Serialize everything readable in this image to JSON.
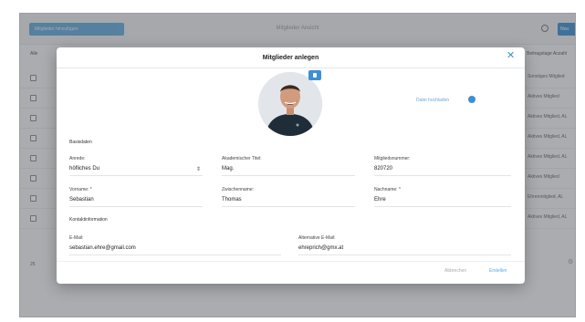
{
  "background": {
    "topbar_button": "Mitglieder hinzufügen",
    "title": "Mitglieder Ansicht",
    "new_button": "Neu",
    "subbar_left": "Alle",
    "subbar_right": "Beitragslage Anzahl",
    "row_statuses": [
      "Sonstiges Mitglied",
      "Aktives Mitglied",
      "Aktives Mitglied, AL",
      "Aktives Mitglied, AL",
      "Aktives Mitglied, AL",
      "Aktives Mitglied",
      "Ehrenmitglied, AL",
      "Aktives Mitglied, AL"
    ],
    "pager": "25"
  },
  "modal": {
    "title": "Mitglieder anlegen",
    "close_label": "✕",
    "link_text": "Datei hochladen",
    "section_basic": "Basisdaten",
    "section_contact": "Kontaktinformation",
    "fields": {
      "anrede": {
        "label": "Anrede:",
        "value": "höfliches Du",
        "arrow": "⇕"
      },
      "titel": {
        "label": "Akademischer Titel:",
        "value": "Mag."
      },
      "mitgliedsnummer": {
        "label": "Mitgliedsnummer:",
        "value": "820720"
      },
      "vorname": {
        "label": "Vorname: *",
        "value": "Sebastian"
      },
      "zwischenname": {
        "label": "Zwischenname:",
        "value": "Thomas"
      },
      "nachname": {
        "label": "Nachname: *",
        "value": "Ehre"
      },
      "email": {
        "label": "E-Mail:",
        "value": "sebastian.ehre@gmail.com"
      },
      "alt_email": {
        "label": "Alternative E-Mail:",
        "value": "ehreprich@gmx.at"
      }
    },
    "cancel_label": "Abbrechen",
    "save_label": "Erstellen"
  },
  "colors": {
    "accent": "#3d8fd3",
    "overlay": "#46484c"
  }
}
